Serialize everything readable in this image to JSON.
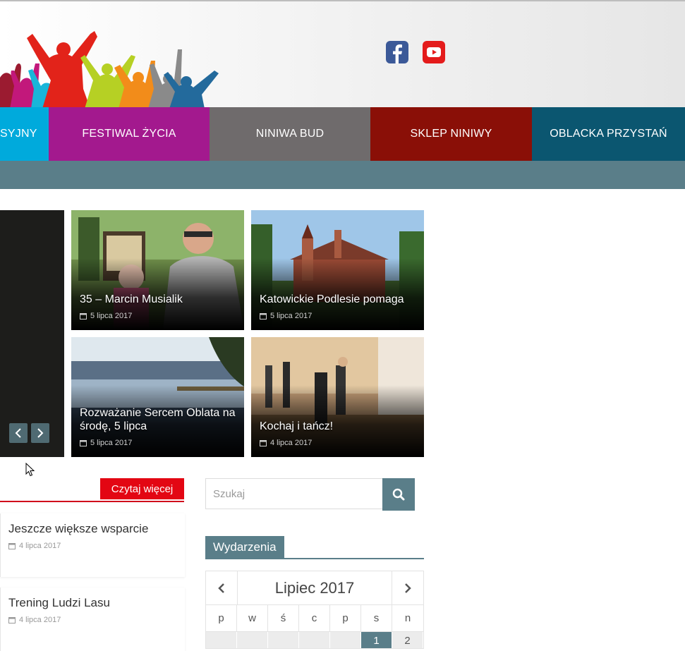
{
  "nav": {
    "items": [
      {
        "label": "SYJNY",
        "color": "#00aadc",
        "width": 69
      },
      {
        "label": "FESTIWAL ŻYCIA",
        "color": "#a3198e",
        "width": 228
      },
      {
        "label": "NINIWA BUD",
        "color": "#6f6b6c",
        "width": 228
      },
      {
        "label": "SKLEP NINIWY",
        "color": "#8a0f07",
        "width": 229
      },
      {
        "label": "OBLACKA PRZYSTAŃ",
        "color": "#0b5670",
        "width": 217
      }
    ]
  },
  "slider": {
    "prev_icon": "chevron-left-icon",
    "next_icon": "chevron-right-icon"
  },
  "tiles": [
    {
      "title": "35 – Marcin Musialik",
      "date": "5 lipca 2017"
    },
    {
      "title": "Katowickie Podlesie pomaga",
      "date": "5 lipca 2017"
    },
    {
      "title": "Rozważanie Sercem Oblata na środę, 5 lipca",
      "date": "5 lipca 2017"
    },
    {
      "title": "Kochaj i tańcz!",
      "date": "4 lipca 2017"
    }
  ],
  "section": {
    "read_more": "Czytaj więcej"
  },
  "posts": [
    {
      "title": "Jeszcze większe wsparcie",
      "date": "4 lipca 2017"
    },
    {
      "title": "Trening Ludzi Lasu",
      "date": "4 lipca 2017"
    }
  ],
  "search": {
    "placeholder": "Szukaj"
  },
  "events": {
    "title": "Wydarzenia",
    "month": "Lipiec 2017",
    "weekdays": [
      "p",
      "w",
      "ś",
      "c",
      "p",
      "s",
      "n"
    ],
    "first_row": [
      "",
      "",
      "",
      "",
      "",
      "1",
      "2"
    ]
  },
  "colors": {
    "accent": "#5a7e89",
    "read_more": "#e30613",
    "facebook": "#3b5998",
    "youtube": "#e41b1b"
  }
}
